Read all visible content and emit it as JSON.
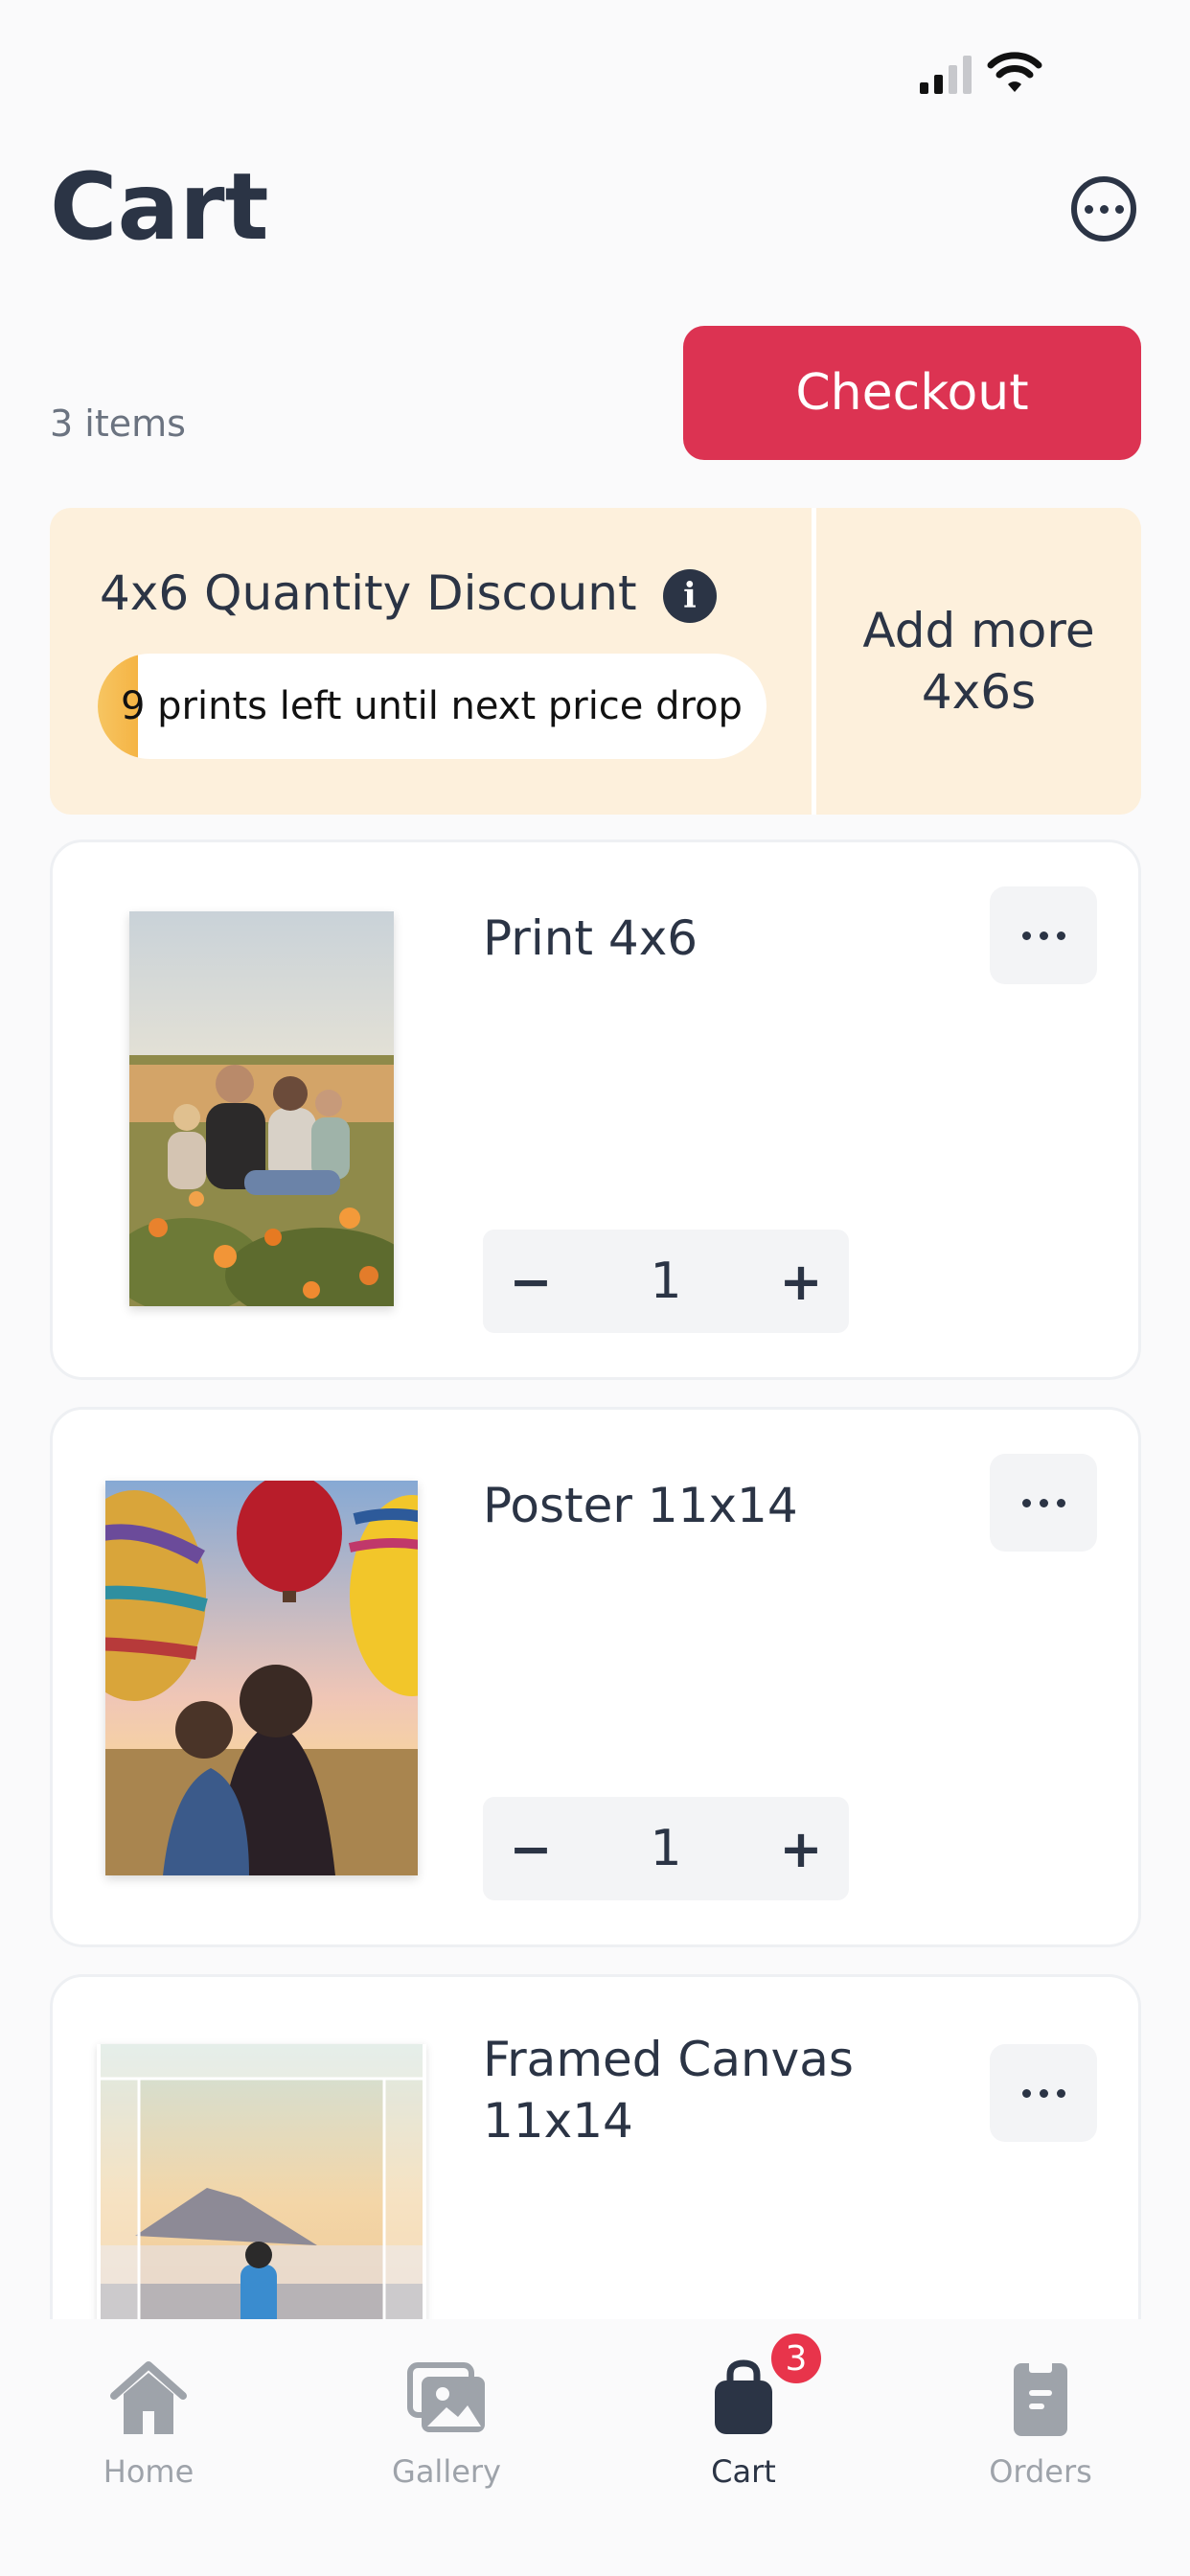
{
  "header": {
    "title": "Cart",
    "more_icon": "more-horizontal-circle-icon"
  },
  "summary": {
    "items_count": "3 items",
    "checkout_label": "Checkout"
  },
  "discount": {
    "title": "4x6 Quantity Discount",
    "info_icon": "info-icon",
    "info_glyph": "i",
    "progress_text": "9 prints left until next price drop",
    "progress_fraction": 0.06,
    "add_more_line1": "Add more",
    "add_more_line2": "4x6s"
  },
  "cart_items": [
    {
      "title_line1": "Print 4x6",
      "title_line2": "",
      "quantity": "1",
      "decrement": "−",
      "increment": "+"
    },
    {
      "title_line1": "Poster 11x14",
      "title_line2": "",
      "quantity": "1",
      "decrement": "−",
      "increment": "+"
    },
    {
      "title_line1": "Framed Canvas",
      "title_line2": "11x14"
    }
  ],
  "nav": {
    "items": [
      {
        "label": "Home",
        "icon": "home-icon"
      },
      {
        "label": "Gallery",
        "icon": "gallery-icon"
      },
      {
        "label": "Cart",
        "icon": "shopping-bag-icon"
      },
      {
        "label": "Orders",
        "icon": "orders-icon"
      }
    ],
    "active": "Cart",
    "cart_badge": "3"
  },
  "colors": {
    "accent": "#dc3352",
    "discount_bg": "#fdf0dc",
    "progress_fill": "#f5b444",
    "text_primary": "#2b3445",
    "nav_inactive": "#9ea3aa",
    "badge": "#e8344b"
  }
}
